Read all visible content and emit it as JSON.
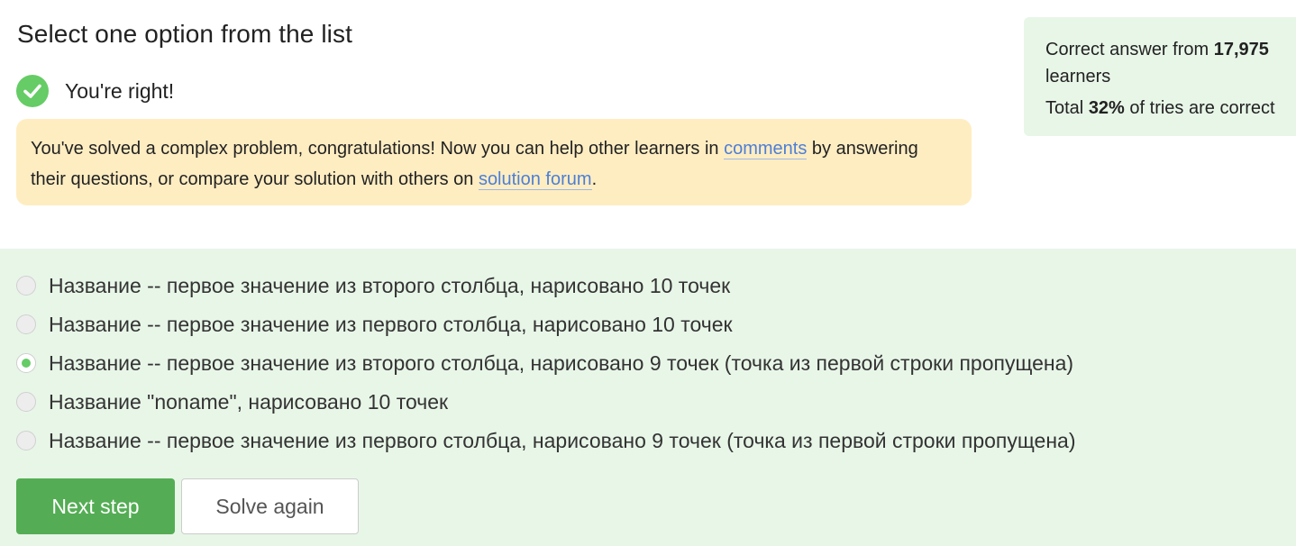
{
  "step": {
    "title": "Select one option from the list",
    "result": "You're right!"
  },
  "hint": {
    "text_before_comments": "You've solved a complex problem, congratulations! Now you can help other learners in ",
    "comments_link": "comments",
    "text_after_comments": " by answering their questions, or compare your solution with others on ",
    "forum_link": "solution forum",
    "text_end": "."
  },
  "stats": {
    "line1_prefix": "Correct answer from ",
    "learners_count": "17,975",
    "line1_suffix": " learners",
    "line2_prefix": "Total ",
    "percent": "32%",
    "line2_suffix": " of tries are correct"
  },
  "options": [
    {
      "label": "Название -- первое значение из второго столбца, нарисовано 10 точек",
      "selected": false
    },
    {
      "label": "Название -- первое значение из первого столбца, нарисовано 10 точек",
      "selected": false
    },
    {
      "label": "Название -- первое значение из второго столбца, нарисовано 9 точек (точка из первой строки пропущена)",
      "selected": true
    },
    {
      "label": "Название \"noname\", нарисовано 10 точек",
      "selected": false
    },
    {
      "label": "Название -- первое значение из первого столбца, нарисовано 9 точек (точка из первой строки пропущена)",
      "selected": false
    }
  ],
  "buttons": {
    "next": "Next step",
    "solve_again": "Solve again"
  },
  "colors": {
    "accent_green": "#54ad54",
    "check_green": "#66cc66",
    "panel_green": "#e8f6e8",
    "hint_bg": "#ffedc2",
    "link": "#4c7fd6"
  },
  "icons": {
    "result": "check-circle-icon"
  }
}
